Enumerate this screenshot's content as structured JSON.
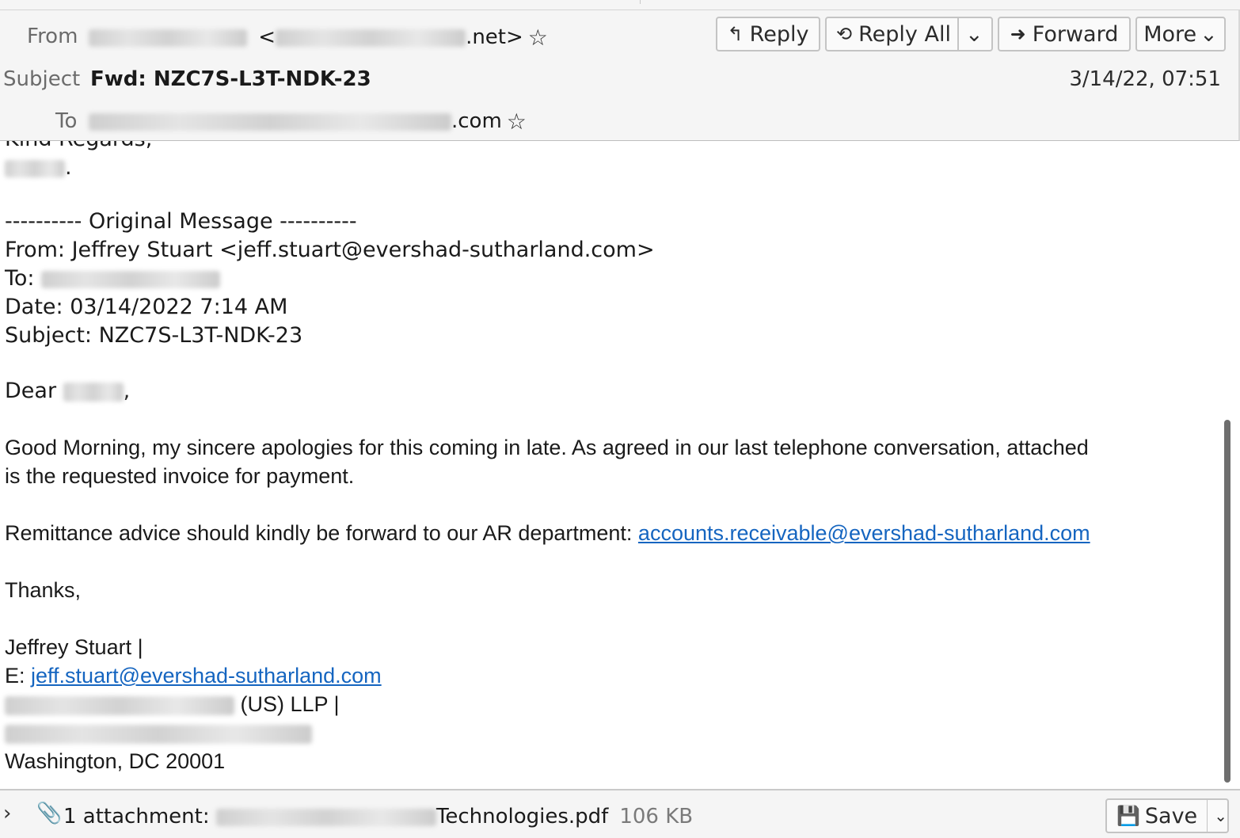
{
  "header": {
    "from_label": "From",
    "from_value_suffix": ".net>",
    "subject_label": "Subject",
    "subject_value": "Fwd: NZC7S-L3T-NDK-23",
    "to_label": "To",
    "to_value_suffix": ".com",
    "date": "3/14/22, 07:51",
    "star_icon": "☆"
  },
  "toolbar": {
    "reply_label": "Reply",
    "reply_all_label": "Reply All",
    "forward_label": "Forward",
    "more_label": "More",
    "reply_icon": "↰",
    "reply_all_icon": "⟲",
    "forward_icon": "➜",
    "dropdown_icon": "⌄"
  },
  "message": {
    "top_cut_text": "Kind Regards,",
    "sign_off_period": ".",
    "original_header": "---------- Original Message ----------",
    "orig_from": "From: Jeffrey Stuart <jeff.stuart@evershad-sutharland.com>",
    "orig_to_label": "To:",
    "orig_date": "Date: 03/14/2022 7:14 AM",
    "orig_subject": "Subject: NZC7S-L3T-NDK-23",
    "dear": "Dear",
    "dear_comma": ",",
    "para1_line1": "Good Morning,  my sincere apologies for this coming in late. As agreed in our last telephone conversation, attached",
    "para1_line2": "is the requested invoice for payment.",
    "remittance_text": "Remittance advice should kindly be forward to our AR department: ",
    "remittance_link": "accounts.receivable@evershad-sutharland.com",
    "thanks": "Thanks,",
    "sig_name": "Jeffrey Stuart |",
    "sig_email_label": "E: ",
    "sig_email": "jeff.stuart@evershad-sutharland.com",
    "sig_firm_suffix": "(US) LLP |",
    "sig_city": "Washington, DC 20001"
  },
  "attachments": {
    "count_label": "1 attachment:",
    "file_suffix": "Technologies.pdf",
    "size": "106 KB",
    "save_label": "Save",
    "expand_icon": "›",
    "paperclip_icon": "📎",
    "save_icon": "💾"
  }
}
